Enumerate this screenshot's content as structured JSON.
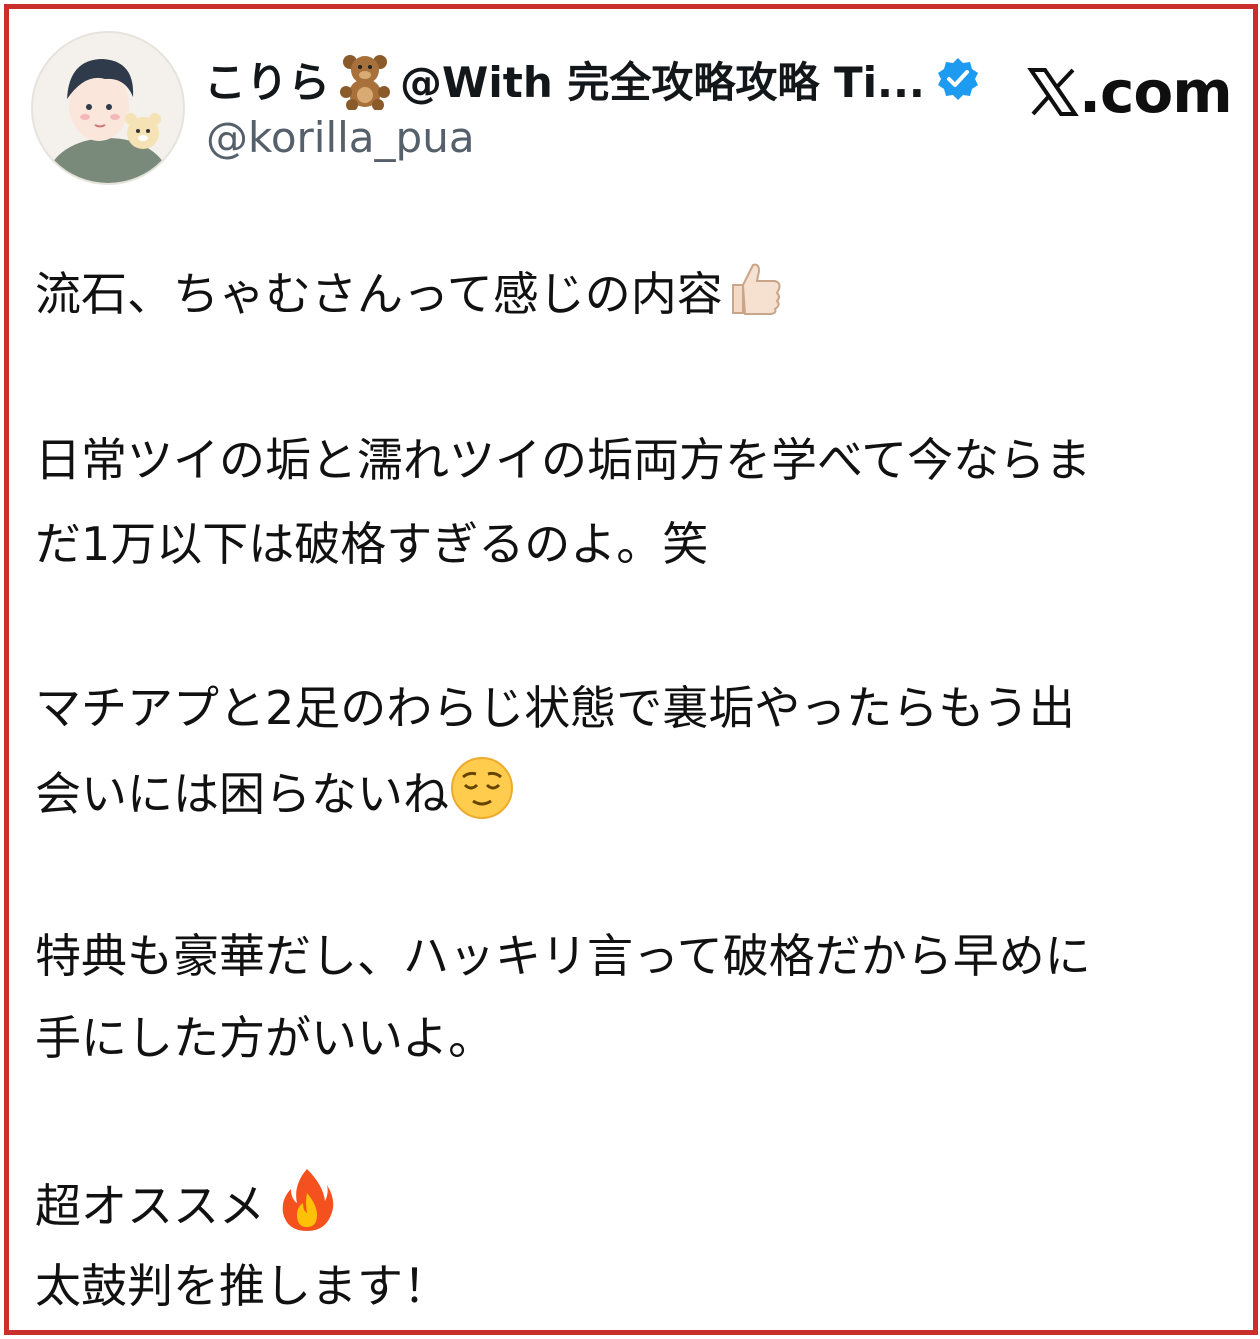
{
  "post": {
    "author": {
      "display_name": "こりら",
      "display_name_suffix": "@With 完全攻略攻略 Ti...",
      "handle": "@korilla_pua",
      "avatar_icon": "illustrated-avatar-with-bear",
      "name_emoji_icon": "teddy-bear-icon",
      "verified_icon": "verified-badge-icon"
    },
    "brand": {
      "logo_icon": "x-logo-icon",
      "text": ".com"
    },
    "lines": [
      "流石、ちゃむさんって感じの内容",
      "日常ツイの垢と濡れツイの垢両方を学べて今ならま",
      "だ1万以下は破格すぎるのよ。笑",
      "マチアプと2足のわらじ状態で裏垢やったらもう出",
      "会いには困らないね",
      "特典も豪華だし、ハッキリ言って破格だから早めに",
      "手にした方がいいよ。",
      "超オススメ",
      "太鼓判を推します！"
    ],
    "emojis": {
      "thumbs_up": "thumbs-up-icon",
      "relieved_face": "relieved-face-icon",
      "fire": "fire-icon"
    }
  },
  "colors": {
    "frame_border": "#c9302c",
    "verified_blue": "#1d9bf0",
    "handle_gray": "#56606b",
    "text": "#111111"
  }
}
